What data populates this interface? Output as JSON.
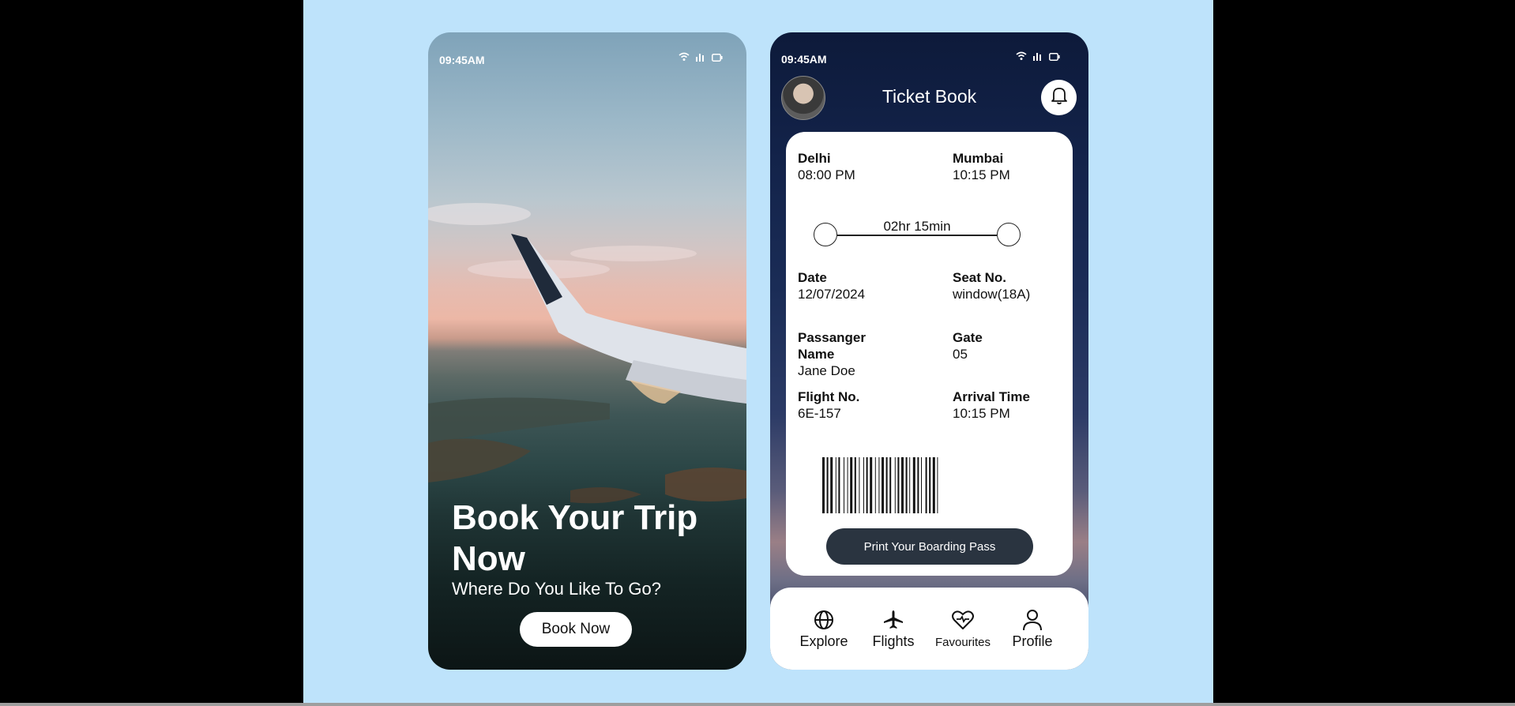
{
  "left_screen": {
    "status_time": "09:45AM",
    "hero_title": "Book Your Trip Now",
    "hero_subtitle": "Where Do You Like To Go?",
    "book_button": "Book Now"
  },
  "right_screen": {
    "status_time": "09:45AM",
    "header_title": "Ticket Book",
    "ticket": {
      "from_city": "Delhi",
      "from_time": "08:00 PM",
      "to_city": "Mumbai",
      "to_time": "10:15 PM",
      "duration": "02hr 15min",
      "date_label": "Date",
      "date_value": "12/07/2024",
      "seat_label": "Seat No.",
      "seat_value": "window(18A)",
      "passenger_label": "Passanger Name",
      "passenger_value": "Jane Doe",
      "gate_label": "Gate",
      "gate_value": "05",
      "flight_label": "Flight No.",
      "flight_value": "6E-157",
      "arrival_label": "Arrival Time",
      "arrival_value": "10:15 PM",
      "print_button": "Print Your Boarding Pass"
    },
    "nav": [
      {
        "label": "Explore",
        "icon": "globe-icon"
      },
      {
        "label": "Flights",
        "icon": "airplane-icon"
      },
      {
        "label": "Favourites",
        "icon": "heart-icon"
      },
      {
        "label": "Profile",
        "icon": "user-icon"
      }
    ]
  },
  "colors": {
    "stage_bg": "#bee3fb",
    "print_button_bg": "#2a3440"
  }
}
